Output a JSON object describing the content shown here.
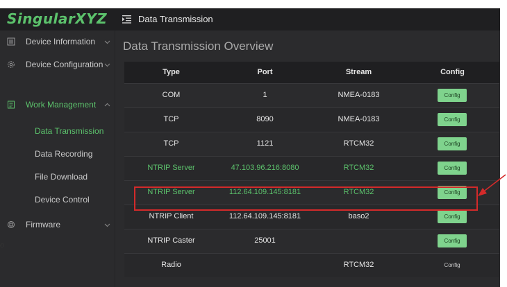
{
  "app": {
    "logo_text": "SingularXYZ",
    "title": "Data Transmission",
    "accent_color": "#5cc26c",
    "highlight_color": "#d42a2a"
  },
  "sidebar": {
    "items": [
      {
        "label": "Device Information",
        "icon": "list-icon",
        "chevron": "down"
      },
      {
        "label": "Device Configuration",
        "icon": "gear-icon",
        "chevron": "down"
      },
      {
        "label": "Work Management",
        "icon": "clipboard-icon",
        "chevron": "up",
        "active": true
      },
      {
        "label": "Firmware",
        "icon": "chip-icon",
        "chevron": "down"
      }
    ],
    "sub_items": [
      {
        "label": "Data Transmission",
        "active": true
      },
      {
        "label": "Data Recording"
      },
      {
        "label": "File Download"
      },
      {
        "label": "Device Control"
      }
    ]
  },
  "main": {
    "page_title": "Data Transmission Overview",
    "table": {
      "headers": [
        "Type",
        "Port",
        "Stream",
        "Config"
      ],
      "rows": [
        {
          "type": "COM",
          "port": "1",
          "stream": "NMEA-0183",
          "config": "Config"
        },
        {
          "type": "TCP",
          "port": "8090",
          "stream": "NMEA-0183",
          "config": "Config"
        },
        {
          "type": "TCP",
          "port": "1121",
          "stream": "RTCM32",
          "config": "Config"
        },
        {
          "type": "NTRIP Server",
          "port": "47.103.96.216:8080",
          "stream": "RTCM32",
          "config": "Config"
        },
        {
          "type": "NTRIP Server",
          "port": "112.64.109.145:8181",
          "stream": "RTCM32",
          "config": "Config"
        },
        {
          "type": "NTRIP Client",
          "port": "112.64.109.145:8181",
          "stream": "baso2",
          "config": "Config"
        },
        {
          "type": "NTRIP Caster",
          "port": "25001",
          "stream": "",
          "config": "Config"
        },
        {
          "type": "Radio",
          "port": "",
          "stream": "RTCM32",
          "config": "Config"
        }
      ]
    }
  },
  "edge_mark": "o"
}
